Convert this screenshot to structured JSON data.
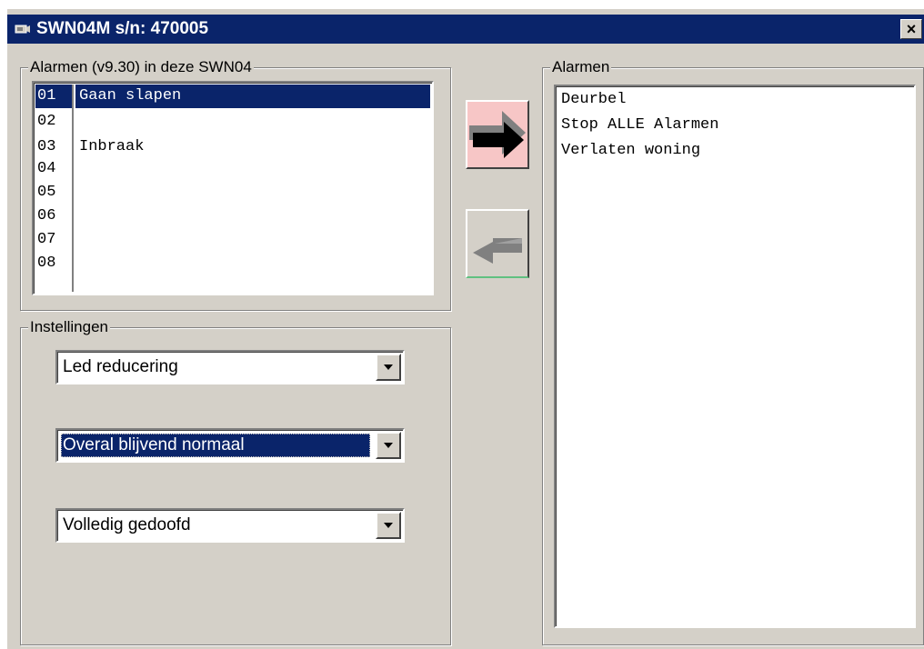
{
  "window": {
    "title": "SWN04M s/n: 470005",
    "close_label": "×"
  },
  "alarm_list_group": {
    "label": "Alarmen (v9.30) in deze SWN04",
    "rows": [
      {
        "num": "01",
        "text": "Gaan slapen",
        "selected": true
      },
      {
        "num": "02",
        "text": ""
      },
      {
        "num": "03",
        "text": "Inbraak"
      },
      {
        "num": "04",
        "text": ""
      },
      {
        "num": "05",
        "text": ""
      },
      {
        "num": "06",
        "text": ""
      },
      {
        "num": "07",
        "text": ""
      },
      {
        "num": "08",
        "text": ""
      }
    ]
  },
  "buttons": {
    "add_icon": "arrow-right-icon",
    "remove_icon": "arrow-left-icon",
    "add_color": "#f7c6c6",
    "remove_color": "#d4d0c8"
  },
  "settings_group": {
    "label": "Instellingen",
    "combo1": "Led reducering",
    "combo2": "Overal blijvend normaal",
    "combo3": "Volledig gedoofd"
  },
  "alarms_group": {
    "label": "Alarmen",
    "items": [
      "Deurbel",
      "Stop ALLE Alarmen",
      "Verlaten woning"
    ]
  },
  "colors": {
    "titlebar": "#0a246a",
    "face": "#d4d0c8",
    "selection": "#0a246a"
  }
}
